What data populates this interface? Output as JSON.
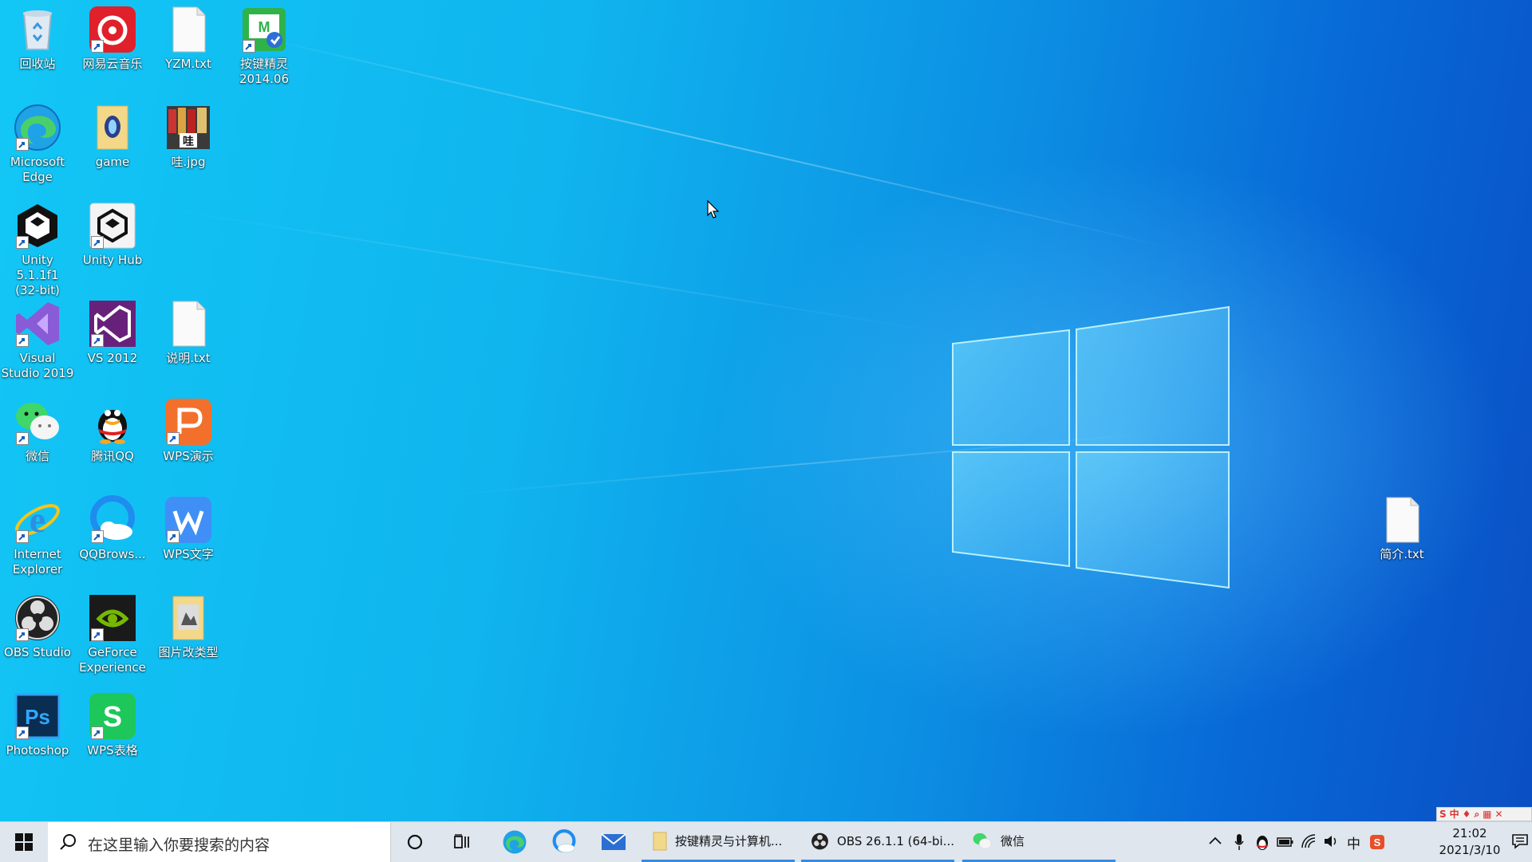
{
  "desktop": {
    "icons": [
      {
        "label": "回收站",
        "icon": "recycle-bin-icon"
      },
      {
        "label": "网易云音乐",
        "icon": "netease-music-icon"
      },
      {
        "label": "YZM.txt",
        "icon": "text-file-icon"
      },
      {
        "label": "按键精灵\n2014.06",
        "icon": "anjian-icon"
      },
      {
        "label": "Microsoft\nEdge",
        "icon": "edge-icon"
      },
      {
        "label": "game",
        "icon": "folder-icon"
      },
      {
        "label": "哇.jpg",
        "icon": "image-file-icon"
      },
      {
        "label": "Unity 5.1.1f1\n(32-bit)",
        "icon": "unity-icon"
      },
      {
        "label": "Unity Hub",
        "icon": "unity-hub-icon"
      },
      {
        "label": "Visual\nStudio 2019",
        "icon": "visual-studio-icon"
      },
      {
        "label": "VS 2012",
        "icon": "vs2012-icon"
      },
      {
        "label": "说明.txt",
        "icon": "text-file-icon"
      },
      {
        "label": "微信",
        "icon": "wechat-icon"
      },
      {
        "label": "腾讯QQ",
        "icon": "qq-icon"
      },
      {
        "label": "WPS演示",
        "icon": "wps-presentation-icon"
      },
      {
        "label": "Internet\nExplorer",
        "icon": "ie-icon"
      },
      {
        "label": "QQBrows...",
        "icon": "qq-browser-icon"
      },
      {
        "label": "WPS文字",
        "icon": "wps-writer-icon"
      },
      {
        "label": "OBS Studio",
        "icon": "obs-icon"
      },
      {
        "label": "GeForce\nExperience",
        "icon": "geforce-icon"
      },
      {
        "label": "图片改类型",
        "icon": "folder-icon"
      },
      {
        "label": "Photoshop",
        "icon": "photoshop-icon"
      },
      {
        "label": "WPS表格",
        "icon": "wps-spreadsheet-icon"
      },
      {
        "label": "简介.txt",
        "icon": "text-file-icon"
      }
    ]
  },
  "taskbar": {
    "search_placeholder": "在这里输入你要搜索的内容",
    "apps": [
      {
        "label": "按键精灵与计算机...",
        "icon": "folder-icon"
      },
      {
        "label": "OBS 26.1.1 (64-bi...",
        "icon": "obs-icon"
      },
      {
        "label": "微信",
        "icon": "wechat-icon"
      }
    ],
    "clock": {
      "time": "21:02",
      "date": "2021/3/10"
    },
    "ime_label": "中"
  },
  "colors": {
    "desktop_bg": "#10b4ee",
    "taskbar_bg": "#dfe6ee",
    "active_underline": "#3a8be0"
  }
}
